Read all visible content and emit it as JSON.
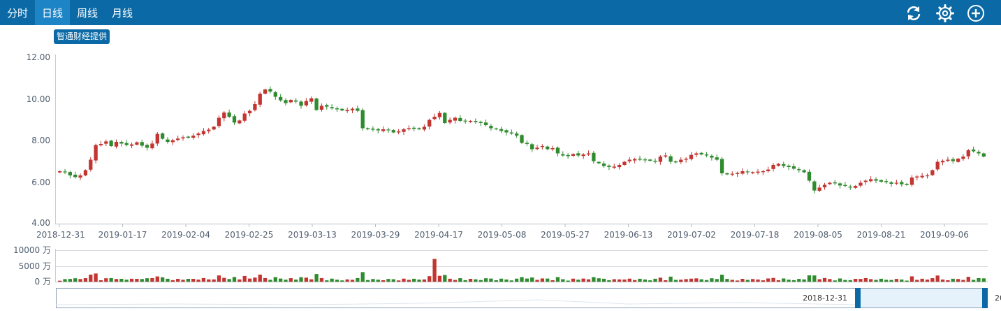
{
  "header": {
    "tabs": [
      "分时",
      "日线",
      "周线",
      "月线"
    ],
    "active_tab": 1,
    "icons": [
      "refresh-icon",
      "gear-icon",
      "add-circle-icon"
    ],
    "source_badge": "智通财经提供"
  },
  "colors": {
    "up": "#c23531",
    "down": "#2e8b2e",
    "nav_handle": "#0b6aa6",
    "header": "#0b6aa6"
  },
  "chart_data": [
    {
      "type": "candlestick",
      "title": "",
      "ylim": [
        4,
        12
      ],
      "y_ticks": [
        "12.00",
        "10.00",
        "8.00",
        "6.00",
        "4.00"
      ],
      "x_tick_labels": [
        "2018-12-31",
        "2019-01-17",
        "2019-02-04",
        "2019-02-25",
        "2019-03-13",
        "2019-03-29",
        "2019-04-17",
        "2019-05-08",
        "2019-05-27",
        "2019-06-13",
        "2019-07-02",
        "2019-07-18",
        "2019-08-05",
        "2019-08-21",
        "2019-09-06"
      ],
      "closes": [
        6.5,
        6.45,
        6.3,
        6.22,
        6.3,
        6.55,
        7.05,
        7.75,
        7.8,
        7.92,
        7.7,
        7.9,
        7.82,
        7.75,
        7.78,
        7.88,
        7.72,
        7.62,
        7.82,
        8.28,
        8.05,
        7.9,
        7.98,
        8.06,
        8.12,
        8.1,
        8.2,
        8.3,
        8.42,
        8.48,
        8.62,
        9.05,
        9.3,
        9.1,
        8.82,
        8.92,
        9.25,
        9.38,
        9.7,
        10.2,
        10.4,
        10.3,
        10.05,
        9.88,
        9.75,
        9.9,
        9.82,
        9.62,
        9.85,
        9.98,
        9.42,
        9.62,
        9.58,
        9.5,
        9.45,
        9.4,
        9.42,
        9.48,
        9.38,
        8.55,
        8.5,
        8.48,
        8.45,
        8.5,
        8.45,
        8.35,
        8.4,
        8.5,
        8.55,
        8.52,
        8.5,
        8.62,
        8.95,
        9.1,
        9.28,
        8.8,
        8.95,
        9.05,
        8.9,
        8.88,
        8.9,
        8.85,
        8.8,
        8.7,
        8.55,
        8.5,
        8.42,
        8.35,
        8.3,
        8.2,
        7.85,
        7.8,
        7.55,
        7.62,
        7.7,
        7.55,
        7.6,
        7.35,
        7.25,
        7.22,
        7.32,
        7.25,
        7.3,
        7.35,
        6.98,
        6.88,
        6.75,
        6.7,
        6.72,
        6.8,
        6.95,
        7.05,
        7.08,
        7.05,
        7.02,
        7.0,
        6.95,
        7.2,
        7.25,
        6.95,
        6.92,
        7.05,
        7.1,
        7.28,
        7.35,
        7.3,
        7.25,
        7.15,
        7.05,
        6.4,
        6.35,
        6.38,
        6.42,
        6.5,
        6.45,
        6.45,
        6.48,
        6.5,
        6.58,
        6.8,
        6.85,
        6.75,
        6.7,
        6.62,
        6.55,
        6.45,
        6.05,
        5.58,
        5.72,
        5.85,
        5.95,
        5.92,
        5.82,
        5.8,
        5.72,
        5.8,
        5.95,
        6.05,
        6.12,
        6.05,
        6.0,
        5.98,
        5.9,
        5.95,
        5.88,
        5.85,
        6.2,
        6.25,
        6.28,
        6.3,
        6.55,
        6.95,
        7.0,
        7.05,
        6.98,
        7.1,
        7.2,
        7.5,
        7.45,
        7.35,
        7.2
      ]
    },
    {
      "type": "bar",
      "title": "",
      "ylim": [
        0,
        10000
      ],
      "y_ticks": [
        "10000 万",
        "5000 万",
        "0 万"
      ]
    }
  ],
  "navigator": {
    "start_date": "2018-12-31",
    "end_date_partial": "20"
  }
}
